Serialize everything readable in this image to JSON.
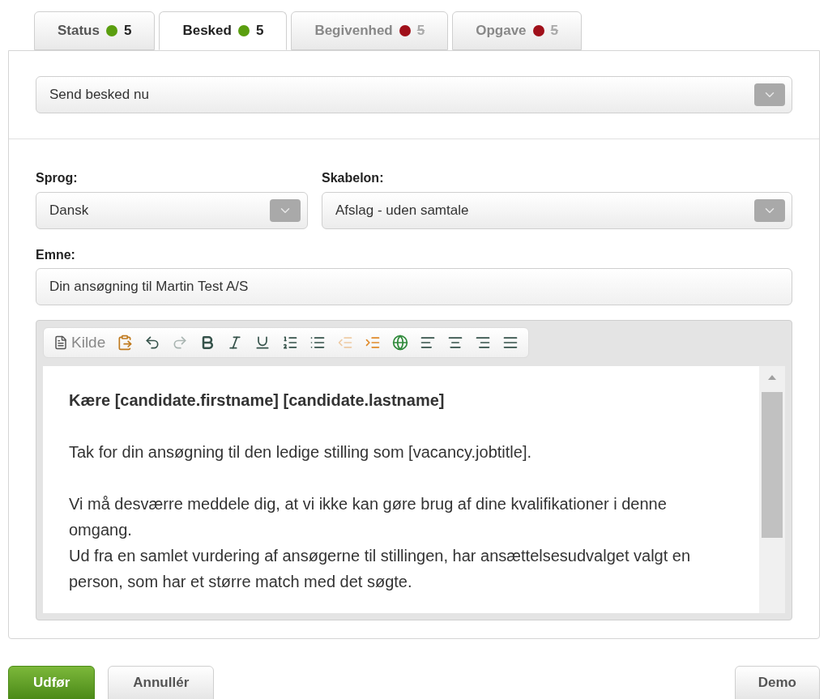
{
  "tabs": [
    {
      "label": "Status",
      "count": "5",
      "color": "#5a9e0f",
      "selected": false,
      "disabled": false
    },
    {
      "label": "Besked",
      "count": "5",
      "color": "#5a9e0f",
      "selected": true,
      "disabled": false
    },
    {
      "label": "Begivenhed",
      "count": "5",
      "color": "#a0101a",
      "selected": false,
      "disabled": true
    },
    {
      "label": "Opgave",
      "count": "5",
      "color": "#a0101a",
      "selected": false,
      "disabled": true
    }
  ],
  "action_select": {
    "value": "Send besked nu"
  },
  "language": {
    "label": "Sprog:",
    "value": "Dansk"
  },
  "template": {
    "label": "Skabelon:",
    "value": "Afslag - uden samtale"
  },
  "subject": {
    "label": "Emne:",
    "value": "Din ansøgning til Martin Test A/S"
  },
  "editor": {
    "toolbar": [
      {
        "kind": "source",
        "label": "Kilde",
        "disabled": false
      },
      {
        "kind": "paste_word",
        "disabled": false
      },
      {
        "kind": "undo",
        "disabled": false
      },
      {
        "kind": "redo",
        "disabled": true
      },
      {
        "kind": "bold",
        "disabled": false
      },
      {
        "kind": "italic",
        "disabled": false
      },
      {
        "kind": "underline",
        "disabled": false
      },
      {
        "kind": "numbered_list",
        "disabled": false
      },
      {
        "kind": "bulleted_list",
        "disabled": false
      },
      {
        "kind": "outdent",
        "disabled": true
      },
      {
        "kind": "indent",
        "disabled": false
      },
      {
        "kind": "link",
        "disabled": false
      },
      {
        "kind": "align_left",
        "disabled": false
      },
      {
        "kind": "align_center",
        "disabled": false
      },
      {
        "kind": "align_right",
        "disabled": false
      },
      {
        "kind": "justify",
        "disabled": false
      }
    ],
    "paragraphs": [
      {
        "bold": true,
        "lines": [
          "Kære [candidate.firstname] [candidate.lastname]"
        ]
      },
      {
        "bold": false,
        "lines": [
          "Tak for din ansøgning til den ledige stilling som [vacancy.jobtitle]."
        ]
      },
      {
        "bold": false,
        "lines": [
          "Vi må desværre meddele dig, at vi ikke kan gøre brug af dine kvalifikationer i denne omgang.",
          "Ud fra en samlet vurdering af ansøgerne til stillingen, har ansættelsesudvalget valgt en person, som har et større match med det søgte."
        ]
      }
    ]
  },
  "buttons": [
    {
      "label": "Udfør",
      "kind": "primary"
    },
    {
      "label": "Annullér",
      "kind": "secondary"
    }
  ],
  "demo_button": {
    "label": "Demo"
  }
}
